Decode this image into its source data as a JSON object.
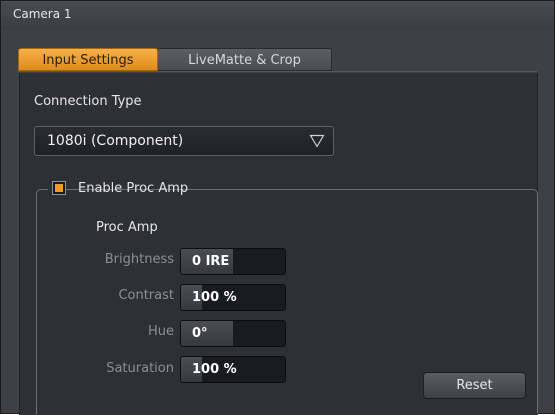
{
  "window": {
    "title": "Camera 1"
  },
  "tabs": [
    {
      "label": "Input Settings",
      "active": true
    },
    {
      "label": "LiveMatte & Crop",
      "active": false
    }
  ],
  "connection": {
    "label": "Connection Type",
    "selected": "1080i (Component)",
    "icon": "triangle-down-icon"
  },
  "proc_amp": {
    "enable_label": "Enable Proc Amp",
    "enabled": true,
    "title": "Proc Amp",
    "params": [
      {
        "label": "Brightness",
        "value": "0 IRE",
        "level": 0.5
      },
      {
        "label": "Contrast",
        "value": "100 %",
        "level": 0.2
      },
      {
        "label": "Hue",
        "value": "0°",
        "level": 0.5
      },
      {
        "label": "Saturation",
        "value": "100 %",
        "level": 0.2
      }
    ],
    "reset_label": "Reset"
  },
  "colors": {
    "accent": "#f09a1e",
    "panel": "#2e3035",
    "chrome": "#3e4046"
  }
}
